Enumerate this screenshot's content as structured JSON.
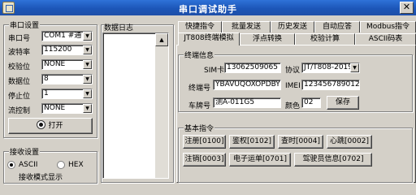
{
  "window": {
    "title": "串口调试助手",
    "close_glyph": "✕"
  },
  "serial": {
    "group_title": "串口设置",
    "port_label": "串口号",
    "port_value": "COM1 #通",
    "baud_label": "波特率",
    "baud_value": "115200",
    "parity_label": "校验位",
    "parity_value": "NONE",
    "data_label": "数据位",
    "data_value": "8",
    "stop_label": "停止位",
    "stop_value": "1",
    "flow_label": "流控制",
    "flow_value": "NONE",
    "open_button": "打开"
  },
  "receive": {
    "group_title": "接收设置",
    "ascii_label": "ASCII",
    "hex_label": "HEX",
    "selected": "ASCII",
    "log_mode_label": "接收模式显示"
  },
  "log": {
    "title": "数据日志"
  },
  "tabs_row1": [
    "快捷指令",
    "批量发送",
    "历史发送",
    "自动应答",
    "Modbus指令"
  ],
  "tabs_row2": [
    "JT808终端模拟",
    "浮点转换",
    "校验计算",
    "ASCII码表"
  ],
  "active_tab": "JT808终端模拟",
  "terminal": {
    "group_title": "终端信息",
    "sim_label": "SIM卡",
    "sim_value": "13062509065",
    "protocol_label": "协议",
    "protocol_value": "JT/T808-2019",
    "terminal_id_label": "终端号",
    "terminal_id_value": "YBAVUQOXOPDBYMI",
    "imei_label": "IMEI",
    "imei_value": "123456789012345",
    "plate_label": "车牌号",
    "plate_value": "测A-011G5",
    "color_label": "颜色",
    "color_value": "02",
    "save_button": "保存"
  },
  "basic": {
    "group_title": "基本指令",
    "buttons": [
      "注册[0100]",
      "鉴权[0102]",
      "查时[0004]",
      "心跳[0002]",
      "注销[0003]",
      "电子运单[0701]",
      "驾驶员信息[0702]"
    ]
  }
}
